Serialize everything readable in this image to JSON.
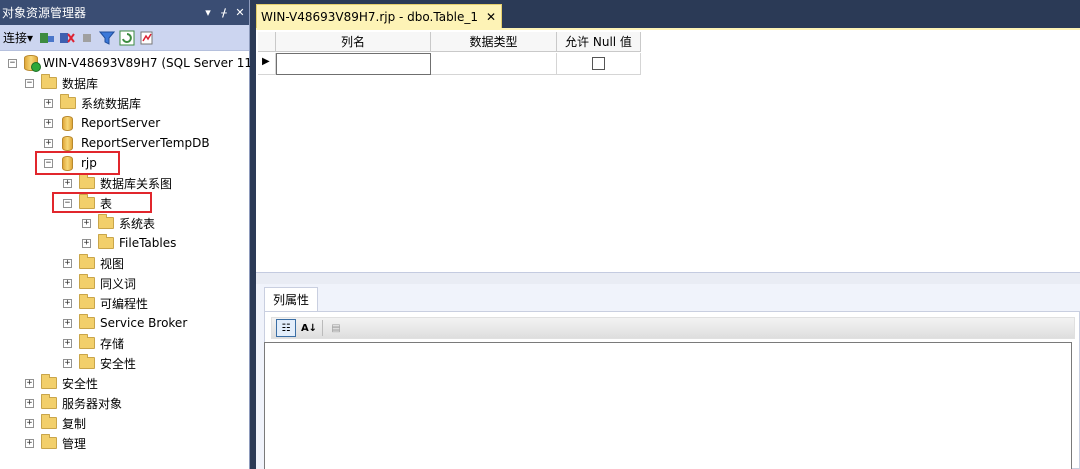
{
  "explorer": {
    "title": "对象资源管理器",
    "controls": {
      "dropdown": "▾",
      "pin": "ᚋ",
      "close": "✕"
    },
    "toolbar": {
      "connect_label": "连接",
      "connect_arrow": "▾"
    }
  },
  "tree": [
    {
      "label": "WIN-V48693V89H7 (SQL Server 11.",
      "icon": "server-icon",
      "expander": "⊟"
    },
    {
      "label": "数据库",
      "icon": "folder-icon",
      "expander": "⊟"
    },
    {
      "label": "系统数据库",
      "icon": "folder-icon",
      "expander": "⊞"
    },
    {
      "label": "ReportServer",
      "icon": "database-icon",
      "expander": "⊞"
    },
    {
      "label": "ReportServerTempDB",
      "icon": "database-icon",
      "expander": "⊞"
    },
    {
      "label": "rjp",
      "icon": "database-icon",
      "expander": "⊟"
    },
    {
      "label": "数据库关系图",
      "icon": "folder-icon",
      "expander": "⊞"
    },
    {
      "label": "表",
      "icon": "folder-icon",
      "expander": "⊟"
    },
    {
      "label": "系统表",
      "icon": "folder-icon",
      "expander": "⊞"
    },
    {
      "label": "FileTables",
      "icon": "folder-icon",
      "expander": "⊞"
    },
    {
      "label": "视图",
      "icon": "folder-icon",
      "expander": "⊞"
    },
    {
      "label": "同义词",
      "icon": "folder-icon",
      "expander": "⊞"
    },
    {
      "label": "可编程性",
      "icon": "folder-icon",
      "expander": "⊞"
    },
    {
      "label": "Service Broker",
      "icon": "folder-icon",
      "expander": "⊞"
    },
    {
      "label": "存储",
      "icon": "folder-icon",
      "expander": "⊞"
    },
    {
      "label": "安全性",
      "icon": "folder-icon",
      "expander": "⊞"
    },
    {
      "label": "安全性",
      "icon": "folder-icon",
      "expander": "⊞"
    },
    {
      "label": "服务器对象",
      "icon": "folder-icon",
      "expander": "⊞"
    },
    {
      "label": "复制",
      "icon": "folder-icon",
      "expander": "⊞"
    },
    {
      "label": "管理",
      "icon": "folder-icon",
      "expander": "⊞"
    }
  ],
  "document": {
    "tab_title": "WIN-V48693V89H7.rjp - dbo.Table_1",
    "tab_close": "✕",
    "columns": [
      "列名",
      "数据类型",
      "允许 Null 值"
    ],
    "row_indicator": "▶"
  },
  "properties": {
    "tab_label": "列属性",
    "categorized_glyph": "☷",
    "alpha_glyph": "A↓",
    "pages_glyph": "▤"
  },
  "colors": {
    "accent_tab": "#fdf3b6",
    "highlight": "#e1262c",
    "panel_title": "#3a4d73"
  }
}
